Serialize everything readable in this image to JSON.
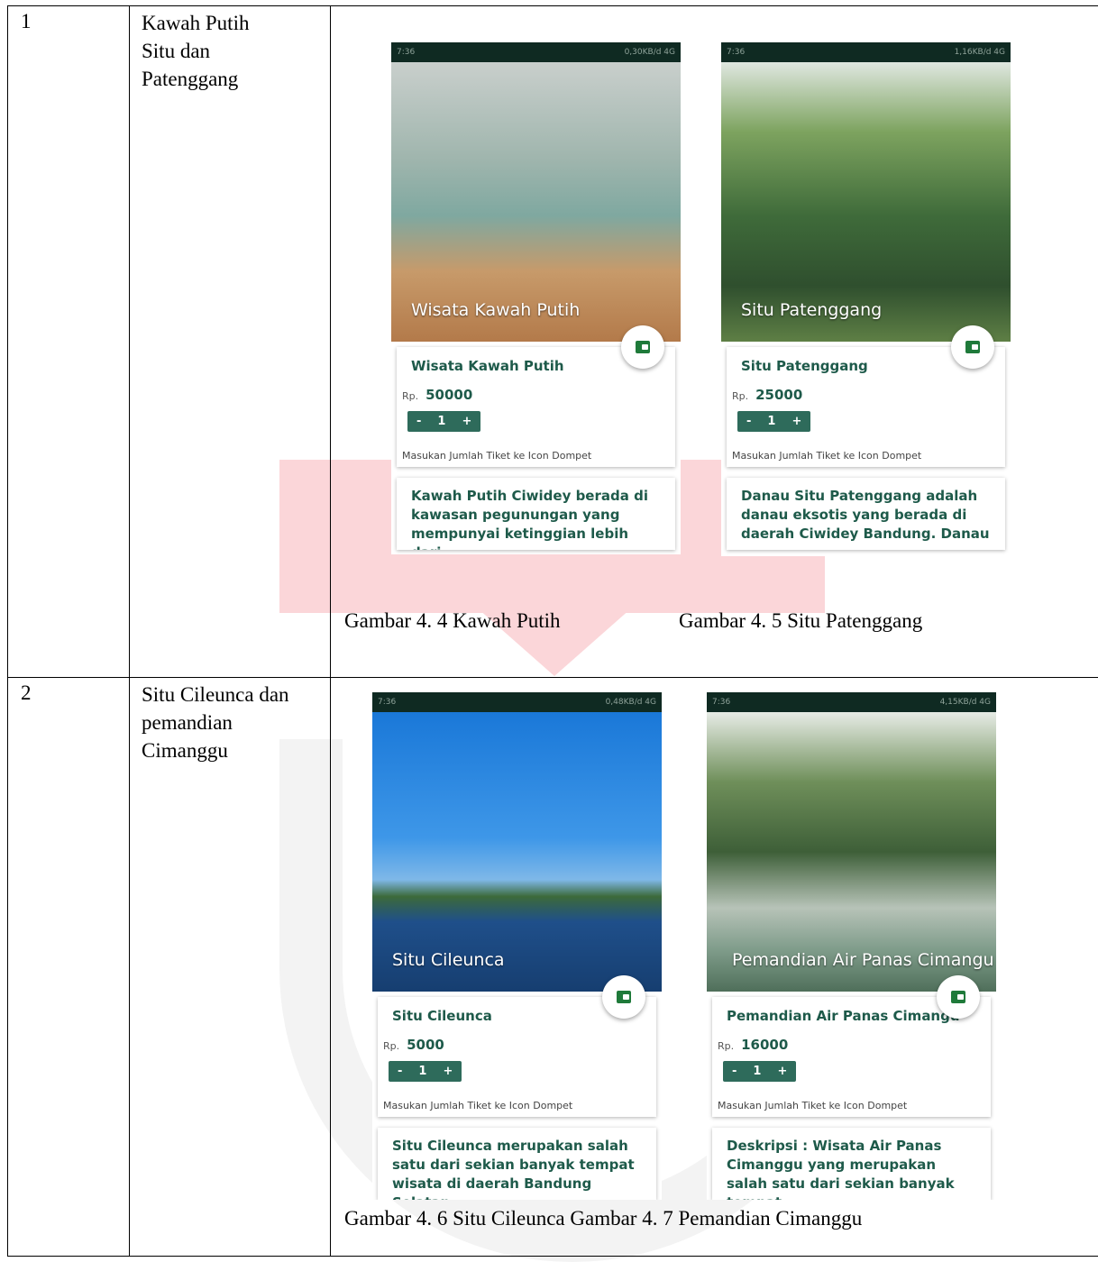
{
  "rows": [
    {
      "number": "1",
      "name_lines": [
        "Kawah Putih",
        "Situ dan",
        "Patenggang"
      ],
      "captions": [
        "Gambar 4. 4 Kawah Putih",
        "Gambar 4. 5 Situ Patenggang"
      ]
    },
    {
      "number": "2",
      "name_lines": [
        "Situ Cileunca dan",
        "pemandian",
        "Cimanggu"
      ],
      "caption": "Gambar 4. 6 Situ Cileunca Gambar 4. 7 Pemandian Cimanggu"
    }
  ],
  "phones": [
    {
      "status_time": "7:36",
      "status_right": "0,30KB/d  4G",
      "hero_title": "Wisata Kawah Putih",
      "title": "Wisata Kawah Putih",
      "currency": "Rp.",
      "price": "50000",
      "qty": "1",
      "minus": "-",
      "plus": "+",
      "hint": "Masukan Jumlah Tiket ke Icon Dompet",
      "desc": "Kawah Putih Ciwidey berada di kawasan pegunungan yang mempunyai ketinggian lebih dari"
    },
    {
      "status_time": "7:36",
      "status_right": "1,16KB/d  4G",
      "hero_title": "Situ Patenggang",
      "title": "Situ Patenggang",
      "currency": "Rp.",
      "price": "25000",
      "qty": "1",
      "minus": "-",
      "plus": "+",
      "hint": "Masukan Jumlah Tiket ke Icon Dompet",
      "desc": "Danau Situ Patenggang adalah danau eksotis yang berada di daerah Ciwidey Bandung. Danau"
    },
    {
      "status_time": "7:36",
      "status_right": "0,48KB/d  4G",
      "hero_title": "Situ Cileunca",
      "title": "Situ Cileunca",
      "currency": "Rp.",
      "price": "5000",
      "qty": "1",
      "minus": "-",
      "plus": "+",
      "hint": "Masukan Jumlah Tiket ke Icon Dompet",
      "desc": "Situ Cileunca merupakan salah satu dari sekian banyak tempat wisata di daerah Bandung Selatan"
    },
    {
      "status_time": "7:36",
      "status_right": "4,15KB/d  4G",
      "hero_title": "Pemandian Air Panas Cimangu",
      "title": "Pemandian Air Panas Cimangu",
      "currency": "Rp.",
      "price": "16000",
      "qty": "1",
      "minus": "-",
      "plus": "+",
      "hint": "Masukan Jumlah Tiket ke Icon Dompet",
      "desc": "Deskripsi : Wisata Air Panas Cimanggu yang merupakan salah satu dari sekian banyak tempat"
    }
  ],
  "hero_colors": [
    "#9fb0a8",
    "#3f6b3a",
    "#2a7fd0",
    "#5c7a55"
  ]
}
